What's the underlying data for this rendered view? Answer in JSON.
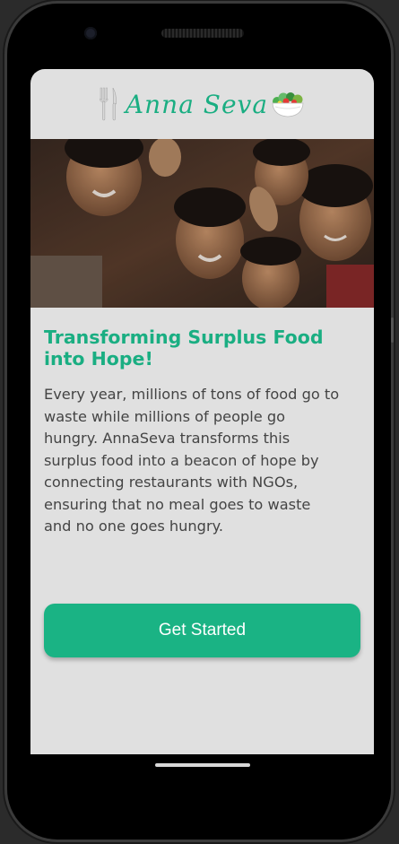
{
  "app": {
    "logo_text": "Anna  Seva",
    "logo_icons": [
      "fork-knife-icon",
      "salad-bowl-icon"
    ]
  },
  "hero": {
    "image_subject": "group of smiling children"
  },
  "onboarding": {
    "title": "Transforming Surplus Food into Hope!",
    "description": "Every year, millions of tons of food go to waste while millions of people go hungry. AnnaSeva transforms this surplus food into a beacon of hope by connecting restaurants with NGOs, ensuring that no meal goes to waste and no one goes hungry.",
    "cta_label": "Get Started"
  },
  "colors": {
    "accent": "#1ab384",
    "title": "#1aae82",
    "screen_bg": "#e0e0e0",
    "text": "#444444"
  }
}
